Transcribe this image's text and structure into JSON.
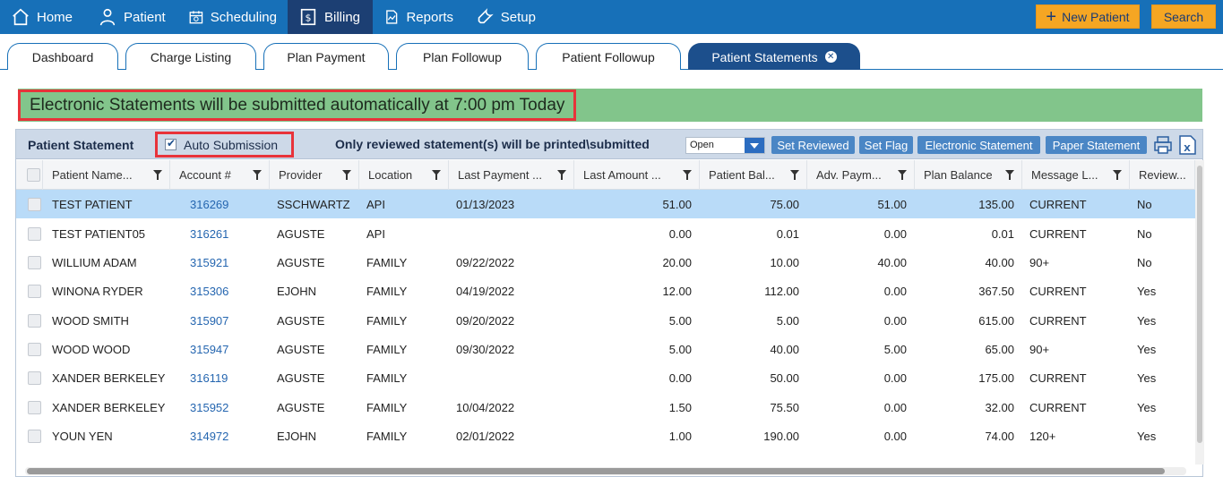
{
  "nav": {
    "items": [
      {
        "label": "Home",
        "icon": "home-icon"
      },
      {
        "label": "Patient",
        "icon": "person-icon"
      },
      {
        "label": "Scheduling",
        "icon": "calendar-icon"
      },
      {
        "label": "Billing",
        "icon": "dollar-icon",
        "active": true
      },
      {
        "label": "Reports",
        "icon": "chart-icon"
      },
      {
        "label": "Setup",
        "icon": "wrench-icon"
      }
    ],
    "new_patient": "New Patient",
    "search": "Search"
  },
  "tabs": [
    {
      "label": "Dashboard"
    },
    {
      "label": "Charge Listing"
    },
    {
      "label": "Plan Payment"
    },
    {
      "label": "Plan Followup"
    },
    {
      "label": "Patient Followup"
    },
    {
      "label": "Patient Statements",
      "active": true
    }
  ],
  "banner": "Electronic Statements will be submitted automatically at 7:00 pm Today",
  "toolbar": {
    "title": "Patient Statement",
    "auto_submission": "Auto Submission",
    "note": "Only reviewed statement(s) will be printed\\submitted",
    "status_select": "Open",
    "set_reviewed": "Set Reviewed",
    "set_flag": "Set Flag",
    "electronic_statement": "Electronic Statement",
    "paper_statement": "Paper Statement"
  },
  "columns": [
    "Patient Name...",
    "Account #",
    "Provider",
    "Location",
    "Last Payment ...",
    "Last Amount ...",
    "Patient Bal...",
    "Adv. Paym...",
    "Plan Balance",
    "Message L...",
    "Review..."
  ],
  "rows": [
    {
      "name": "TEST PATIENT",
      "account": "316269",
      "provider": "SSCHWARTZ",
      "location": "API",
      "last_payment": "01/13/2023",
      "last_amount": "51.00",
      "patient_bal": "75.00",
      "adv_pay": "51.00",
      "plan_bal": "135.00",
      "message": "CURRENT",
      "reviewed": "No",
      "selected": true
    },
    {
      "name": "TEST PATIENT05",
      "account": "316261",
      "provider": "AGUSTE",
      "location": "API",
      "last_payment": "",
      "last_amount": "0.00",
      "patient_bal": "0.01",
      "adv_pay": "0.00",
      "plan_bal": "0.01",
      "message": "CURRENT",
      "reviewed": "No"
    },
    {
      "name": "WILLIUM ADAM",
      "account": "315921",
      "provider": "AGUSTE",
      "location": "FAMILY",
      "last_payment": "09/22/2022",
      "last_amount": "20.00",
      "patient_bal": "10.00",
      "adv_pay": "40.00",
      "plan_bal": "40.00",
      "message": "90+",
      "reviewed": "No"
    },
    {
      "name": "WINONA RYDER",
      "account": "315306",
      "provider": "EJOHN",
      "location": "FAMILY",
      "last_payment": "04/19/2022",
      "last_amount": "12.00",
      "patient_bal": "112.00",
      "adv_pay": "0.00",
      "plan_bal": "367.50",
      "message": "CURRENT",
      "reviewed": "Yes"
    },
    {
      "name": "WOOD SMITH",
      "account": "315907",
      "provider": "AGUSTE",
      "location": "FAMILY",
      "last_payment": "09/20/2022",
      "last_amount": "5.00",
      "patient_bal": "5.00",
      "adv_pay": "0.00",
      "plan_bal": "615.00",
      "message": "CURRENT",
      "reviewed": "Yes"
    },
    {
      "name": "WOOD WOOD",
      "account": "315947",
      "provider": "AGUSTE",
      "location": "FAMILY",
      "last_payment": "09/30/2022",
      "last_amount": "5.00",
      "patient_bal": "40.00",
      "adv_pay": "5.00",
      "plan_bal": "65.00",
      "message": "90+",
      "reviewed": "Yes"
    },
    {
      "name": "XANDER BERKELEY",
      "account": "316119",
      "provider": "AGUSTE",
      "location": "FAMILY",
      "last_payment": "",
      "last_amount": "0.00",
      "patient_bal": "50.00",
      "adv_pay": "0.00",
      "plan_bal": "175.00",
      "message": "CURRENT",
      "reviewed": "Yes"
    },
    {
      "name": "XANDER BERKELEY",
      "account": "315952",
      "provider": "AGUSTE",
      "location": "FAMILY",
      "last_payment": "10/04/2022",
      "last_amount": "1.50",
      "patient_bal": "75.50",
      "adv_pay": "0.00",
      "plan_bal": "32.00",
      "message": "CURRENT",
      "reviewed": "Yes"
    },
    {
      "name": "YOUN YEN",
      "account": "314972",
      "provider": "EJOHN",
      "location": "FAMILY",
      "last_payment": "02/01/2022",
      "last_amount": "1.00",
      "patient_bal": "190.00",
      "adv_pay": "0.00",
      "plan_bal": "74.00",
      "message": "120+",
      "reviewed": "Yes"
    }
  ]
}
